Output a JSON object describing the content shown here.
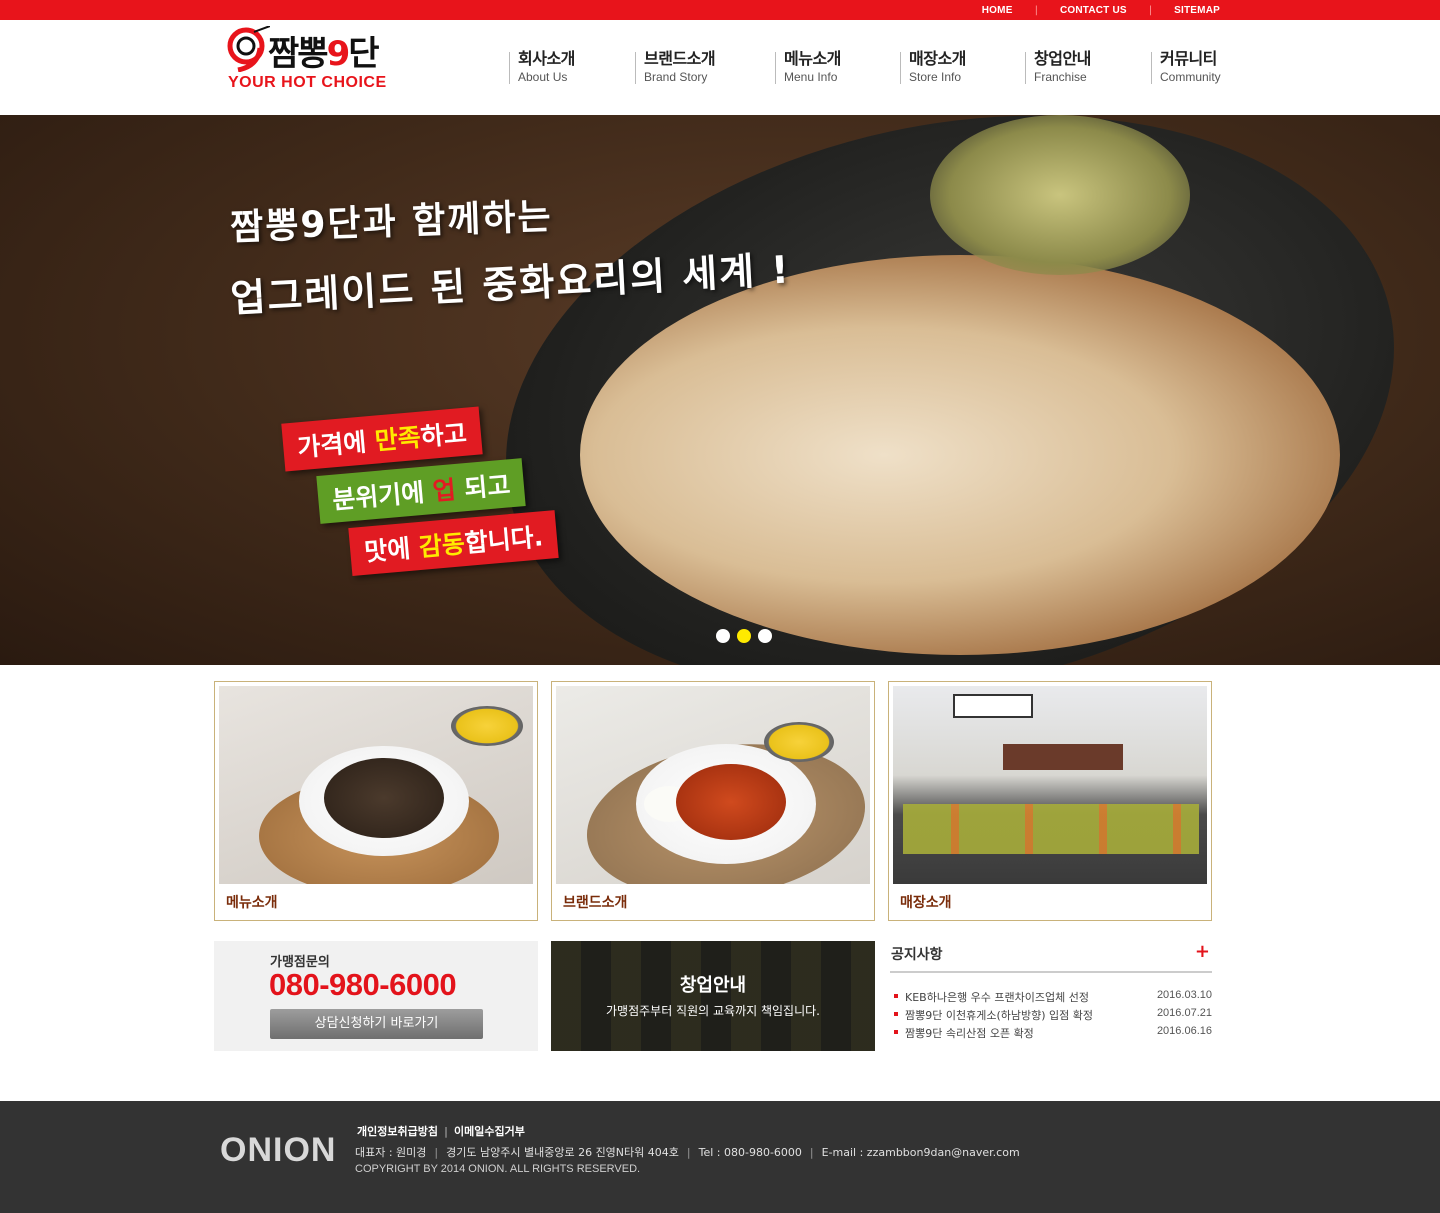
{
  "topbar": {
    "links": [
      "HOME",
      "CONTACT US",
      "SITEMAP"
    ],
    "color": "#e8141b"
  },
  "logo": {
    "brand_prefix": "짬뽕",
    "brand_nine": "9",
    "brand_suffix": "단",
    "tagline": "YOUR HOT CHOICE"
  },
  "nav": [
    {
      "ko": "회사소개",
      "en": "About Us"
    },
    {
      "ko": "브랜드소개",
      "en": "Brand Story"
    },
    {
      "ko": "메뉴소개",
      "en": "Menu Info"
    },
    {
      "ko": "매장소개",
      "en": "Store Info"
    },
    {
      "ko": "창업안내",
      "en": "Franchise"
    },
    {
      "ko": "커뮤니티",
      "en": "Community"
    }
  ],
  "hero": {
    "line1": "짬뽕9단과 함께하는",
    "line2": "업그레이드 된 중화요리의 세계 !",
    "badges": [
      {
        "pre": "가격에 ",
        "hl": "만족",
        "post": "하고"
      },
      {
        "pre": "분위기에 ",
        "hl": "업",
        "post": " 되고"
      },
      {
        "pre": "맛에 ",
        "hl": "감동",
        "post": "합니다."
      }
    ],
    "slides": 3,
    "active_slide": 2
  },
  "cards": [
    {
      "label": "메뉴소개"
    },
    {
      "label": "브랜드소개"
    },
    {
      "label": "매장소개"
    }
  ],
  "consult": {
    "title": "가맹점문의",
    "phone": "080-980-6000",
    "button": "상담신청하기 바로가기"
  },
  "franchise": {
    "title": "창업안내",
    "subtitle": "가맹점주부터 직원의 교육까지 책임집니다."
  },
  "notice": {
    "title": "공지사항",
    "more": "+",
    "items": [
      {
        "text": "KEB하나은행 우수 프랜차이즈업체 선정",
        "date": "2016.03.10"
      },
      {
        "text": "짬뽕9단 이천휴게소(하남방향) 입점 확정",
        "date": "2016.07.21"
      },
      {
        "text": "짬뽕9단 속리산점 오픈 확정",
        "date": "2016.06.16"
      }
    ]
  },
  "footer": {
    "logo": "ONION",
    "links": [
      "개인정보취급방침",
      "이메일수집거부"
    ],
    "info": [
      "대표자 : 원미경",
      "경기도 남양주시 별내중앙로 26 진영N타워 404호",
      "Tel : 080-980-6000",
      "E-mail : zzambbon9dan@naver.com"
    ],
    "copyright": "COPYRIGHT BY 2014 ONION. ALL RIGHTS RESERVED."
  }
}
